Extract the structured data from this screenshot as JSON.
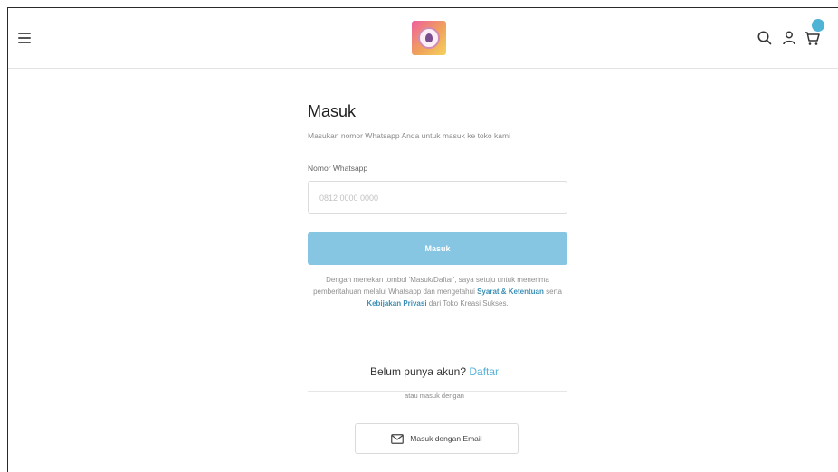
{
  "header": {
    "menu_icon": "hamburger-menu-icon",
    "logo_icon": "store-logo",
    "search_icon": "search-icon",
    "account_icon": "user-icon",
    "cart_icon": "cart-icon",
    "accent": "#58b2d8"
  },
  "login": {
    "title": "Masuk",
    "subtitle": "Masukan nomor Whatsapp Anda untuk masuk ke toko kami",
    "phone_label": "Nomor Whatsapp",
    "phone_placeholder": "0812 0000 0000",
    "phone_value": "",
    "submit_label": "Masuk",
    "terms_text_1": "Dengan menekan tombol 'Masuk/Daftar', saya setuju untuk menerima pemberitahuan melalui Whatsapp dan mengetahui",
    "terms_link_1": "Syarat & Ketentuan",
    "terms_text_2": "serta",
    "terms_link_2": "Kebijakan Privasi",
    "terms_text_3": "dari Toko Kreasi Sukses.",
    "signup_prompt": "Belum punya akun?",
    "signup_link": "Daftar",
    "divider_label": "atau masuk dengan",
    "email_button_label": "Masuk dengan Email",
    "email_icon": "mail-icon"
  }
}
